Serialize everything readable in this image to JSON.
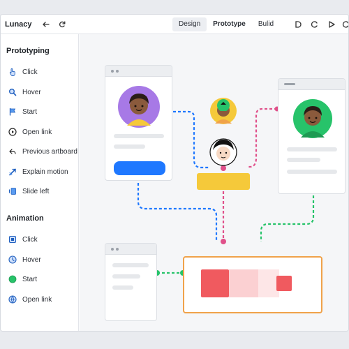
{
  "app": {
    "title": "Lunacy"
  },
  "toolbar": {
    "back_icon": "arrow-left-icon",
    "refresh_icon": "refresh-icon",
    "tabs": [
      {
        "label": "Design",
        "active": true
      },
      {
        "label": "Prototype",
        "active": false
      },
      {
        "label": "Bulid",
        "active": false
      }
    ],
    "right_icons": [
      "mask-icon",
      "link-icon",
      "play-icon",
      "more-icon"
    ]
  },
  "sidebar": {
    "prototyping_title": "Prototyping",
    "prototyping_items": [
      {
        "label": "Click",
        "icon": "hand-pointer-icon"
      },
      {
        "label": "Hover",
        "icon": "magnifier-icon"
      },
      {
        "label": "Start",
        "icon": "flag-icon"
      },
      {
        "label": "Open link",
        "icon": "play-circle-icon"
      },
      {
        "label": "Previous artboard",
        "icon": "back-arrow-icon"
      },
      {
        "label": "Explain motion",
        "icon": "motion-icon"
      },
      {
        "label": "Slide left",
        "icon": "slide-icon"
      }
    ],
    "animation_title": "Animation",
    "animation_items": [
      {
        "label": "Click",
        "icon": "square-icon"
      },
      {
        "label": "Hover",
        "icon": "clock-icon"
      },
      {
        "label": "Start",
        "icon": "green-dot-icon"
      },
      {
        "label": "Open link",
        "icon": "globe-icon"
      }
    ]
  },
  "colors": {
    "blue": "#1f78ff",
    "yellow": "#f5c93a",
    "pink": "#e0508a",
    "green": "#27c36a",
    "orange": "#f0a24a",
    "red": "#f05a5f",
    "purple": "#a779e6"
  }
}
